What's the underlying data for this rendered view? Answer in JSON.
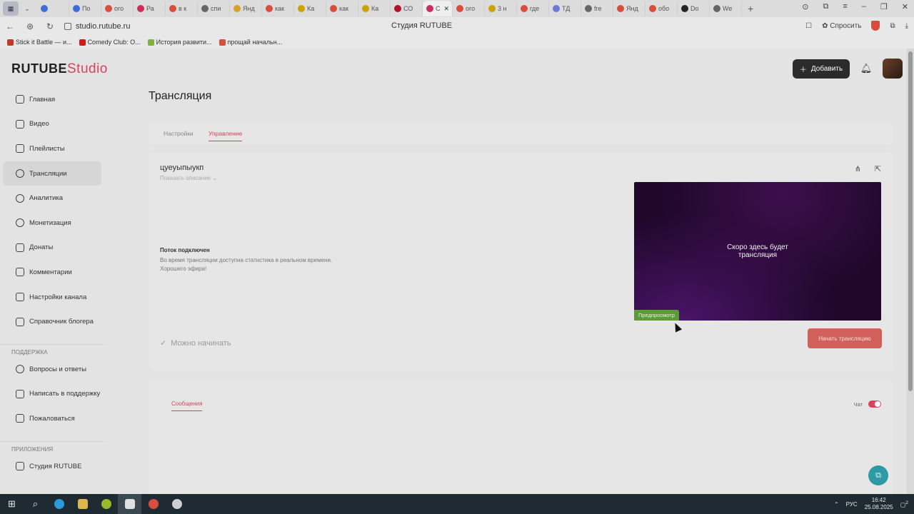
{
  "browser": {
    "tabs": [
      {
        "label": "",
        "color": "#3b6fd6"
      },
      {
        "label": "По",
        "color": "#3b6fd6"
      },
      {
        "label": "ого",
        "color": "#d94d3c"
      },
      {
        "label": "Ра",
        "color": "#cc2d5a"
      },
      {
        "label": "в к",
        "color": "#d94d3c"
      },
      {
        "label": "спи",
        "color": "#666666"
      },
      {
        "label": "Янд",
        "color": "#d9a02e"
      },
      {
        "label": "как",
        "color": "#d94d3c"
      },
      {
        "label": "Ка",
        "color": "#caa400"
      },
      {
        "label": "как",
        "color": "#d94d3c"
      },
      {
        "label": "Ка",
        "color": "#caa400"
      },
      {
        "label": "СО",
        "color": "#b3122e"
      },
      {
        "label": "С",
        "color": "#cc2d5a",
        "active": true
      },
      {
        "label": "ого",
        "color": "#d94d3c"
      },
      {
        "label": "3 н",
        "color": "#caa400"
      },
      {
        "label": "где",
        "color": "#d94d3c"
      },
      {
        "label": "ТД",
        "color": "#6a7ad6"
      },
      {
        "label": "fre",
        "color": "#666666"
      },
      {
        "label": "Янд",
        "color": "#d94d3c"
      },
      {
        "label": "обо",
        "color": "#d94d3c"
      },
      {
        "label": "Do",
        "color": "#222222"
      },
      {
        "label": "We",
        "color": "#666666"
      }
    ],
    "url": "studio.rutube.ru",
    "page_title": "Студия RUTUBE",
    "ask_label": "Спросить",
    "bookmarks": [
      {
        "label": "Stick it Battle — и...",
        "color": "#c0392b"
      },
      {
        "label": "Comedy Club: О...",
        "color": "#d11a1a"
      },
      {
        "label": "История развити...",
        "color": "#7cb342"
      },
      {
        "label": "прощай начальн...",
        "color": "#d94d3c"
      }
    ]
  },
  "header": {
    "logo_main": "RUTUBE",
    "logo_studio": "Studio",
    "add_button": "Добавить"
  },
  "sidebar": {
    "items": [
      {
        "label": "Главная",
        "icon": "home-icon"
      },
      {
        "label": "Видео",
        "icon": "video-icon"
      },
      {
        "label": "Плейлисты",
        "icon": "playlist-icon"
      },
      {
        "label": "Трансляции",
        "icon": "broadcast-icon",
        "active": true
      },
      {
        "label": "Аналитика",
        "icon": "analytics-icon"
      },
      {
        "label": "Монетизация",
        "icon": "monetization-icon"
      },
      {
        "label": "Донаты",
        "icon": "donations-icon"
      },
      {
        "label": "Комментарии",
        "icon": "comments-icon"
      },
      {
        "label": "Настройки канала",
        "icon": "settings-icon"
      },
      {
        "label": "Справочник блогера",
        "icon": "guide-icon"
      }
    ],
    "support_section": "ПОДДЕРЖКА",
    "support_items": [
      {
        "label": "Вопросы и ответы",
        "icon": "faq-icon"
      },
      {
        "label": "Написать в поддержку",
        "icon": "mail-icon"
      },
      {
        "label": "Пожаловаться",
        "icon": "flag-icon"
      }
    ],
    "apps_section": "ПРИЛОЖЕНИЯ",
    "apps_items": [
      {
        "label": "Студия RUTUBE",
        "icon": "studio-app-icon"
      }
    ]
  },
  "main": {
    "title": "Трансляция",
    "tabs": [
      {
        "label": "Настройки"
      },
      {
        "label": "Управление",
        "active": true
      }
    ],
    "stream_name": "цуеуыпыукп",
    "show_description": "Показать описание",
    "status_title": "Поток подключен",
    "status_text_1": "Во время трансляции доступна статистика в реальном времени.",
    "status_text_2": "Хорошего эфира!",
    "ready_label": "Можно начинать",
    "preview_text_1": "Скоро здесь будет",
    "preview_text_2": "трансляция",
    "preview_badge": "Предпросмотр",
    "start_button": "Начать трансляцию"
  },
  "chat": {
    "messages_tab": "Сообщения",
    "chat_label": "Чат",
    "chat_enabled": true
  },
  "taskbar": {
    "language": "РУС",
    "time": "16:42",
    "date": "25.08.2025",
    "notifications": "2"
  },
  "colors": {
    "accent": "#d8425f",
    "preview_badge": "#5c9a3a",
    "start_button": "#d1605a",
    "help_fab": "#2d9aa6"
  }
}
